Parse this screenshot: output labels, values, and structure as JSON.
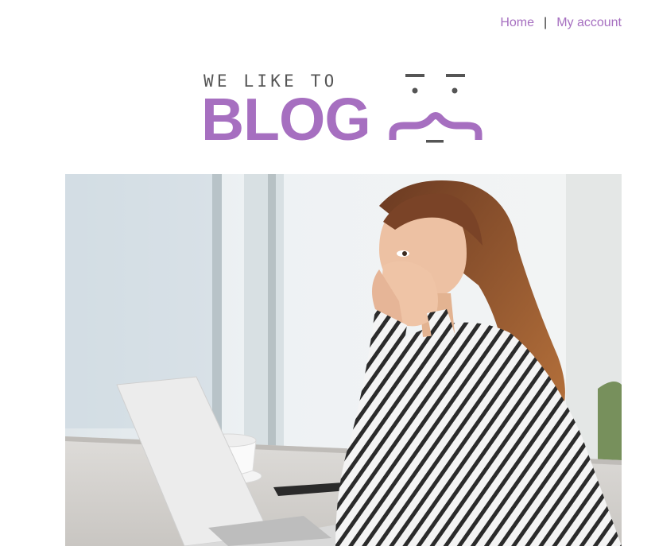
{
  "nav": {
    "home_label": "Home",
    "separator": "|",
    "account_label": "My account"
  },
  "logo": {
    "tagline": "WE LIKE TO",
    "brand": "BLOG",
    "face_icon": "smirk-face-icon"
  },
  "hero": {
    "icon": "photo-surprised-woman-at-laptop"
  },
  "colors": {
    "accent": "#a66fc0",
    "logo_gray": "#555555",
    "text": "#333333"
  }
}
